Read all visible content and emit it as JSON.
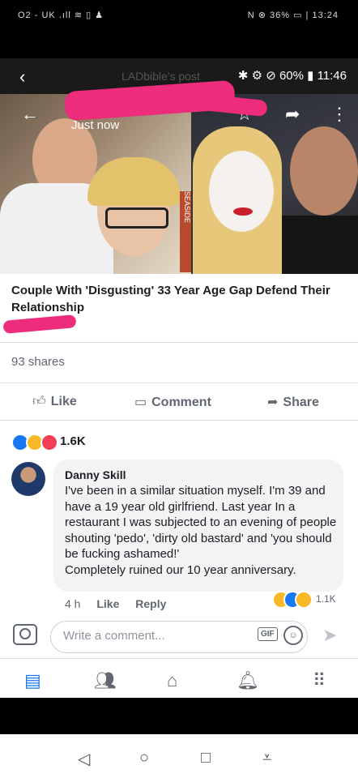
{
  "outer_status": {
    "carrier": "O2 - UK",
    "right_text": "36%",
    "time": "13:24"
  },
  "inner_status": {
    "battery": "60%",
    "time": "11:46",
    "post_title": "LADbible's post"
  },
  "photo": {
    "timestamp": "Just now",
    "side_sign": "SEASIDE"
  },
  "post": {
    "headline": "Couple With 'Disgusting' 33 Year Age Gap Defend Their Relationship",
    "shares": "93 shares",
    "actions": {
      "like": "Like",
      "comment": "Comment",
      "share": "Share"
    },
    "reaction_count": "1.6K"
  },
  "comment": {
    "author": "Danny Skill",
    "text": "I've been in a similar situation  myself. I'm 39 and have a 19 year old girlfriend. Last year In a restaurant I was subjected to an evening of people shouting 'pedo', 'dirty old bastard' and 'you should be fucking ashamed!'\nCompletely ruined our 10 year anniversary.",
    "time": "4 h",
    "like": "Like",
    "reply": "Reply",
    "reaction_count": "1.1K"
  },
  "composer": {
    "placeholder": "Write a comment...",
    "gif": "GIF"
  },
  "colors": {
    "fb_blue": "#1877f2",
    "highlight_pink": "#ee2c7c",
    "text_grey": "#606770"
  },
  "icons": {
    "back": "arrow-left-icon",
    "star": "star-icon",
    "share": "share-arrow-icon",
    "more": "more-vertical-icon"
  }
}
